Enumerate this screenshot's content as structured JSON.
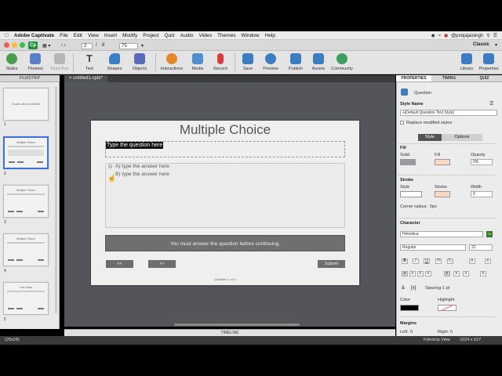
{
  "menubar": {
    "app": "Adobe Captivate",
    "items": [
      "File",
      "Edit",
      "View",
      "Insert",
      "Modify",
      "Project",
      "Quiz",
      "Audio",
      "Video",
      "Themes",
      "Window",
      "Help"
    ],
    "user": "@poojajaisingh"
  },
  "titlebar": {
    "logo": "Cp",
    "page_current": "2",
    "page_sep": "/",
    "page_total": "8",
    "zoom": "75",
    "mode": "Classic"
  },
  "toolbar": {
    "items": [
      {
        "label": "Slides",
        "icon": "slides-icon",
        "color": "#4a9d4f"
      },
      {
        "label": "Themes",
        "icon": "themes-icon",
        "color": "#5a7fc9"
      },
      {
        "label": "Fluid Box",
        "icon": "fluid-box-icon",
        "color": "#b7b7b7"
      },
      {
        "label": "Text",
        "icon": "text-icon",
        "color": "#444444"
      },
      {
        "label": "Shapes",
        "icon": "shapes-icon",
        "color": "#3a7fc1"
      },
      {
        "label": "Objects",
        "icon": "objects-icon",
        "color": "#5c6bb8"
      },
      {
        "label": "Interactions",
        "icon": "interactions-icon",
        "color": "#e0882c"
      },
      {
        "label": "Media",
        "icon": "media-icon",
        "color": "#4f8fcf"
      },
      {
        "label": "Record",
        "icon": "record-icon",
        "color": "#d93a3a"
      },
      {
        "label": "Save",
        "icon": "save-icon",
        "color": "#3c7cc1"
      },
      {
        "label": "Preview",
        "icon": "preview-icon",
        "color": "#3c7cc1"
      },
      {
        "label": "Publish",
        "icon": "publish-icon",
        "color": "#3c7cc1"
      },
      {
        "label": "Assets",
        "icon": "assets-icon",
        "color": "#3c7cc1"
      },
      {
        "label": "Community",
        "icon": "community-icon",
        "color": "#3aa060"
      },
      {
        "label": "Library",
        "icon": "library-icon",
        "color": "#3c7cc1"
      },
      {
        "label": "Properties",
        "icon": "properties-icon",
        "color": "#3c7cc1"
      }
    ]
  },
  "filmstrip": {
    "header": "FILMSTRIP",
    "slides": [
      {
        "num": "1",
        "title": "Double click to edit title"
      },
      {
        "num": "2",
        "title": "Multiple Choice"
      },
      {
        "num": "3",
        "title": "Multiple Choice"
      },
      {
        "num": "4",
        "title": "Multiple Choice"
      },
      {
        "num": "5",
        "title": "True False"
      }
    ]
  },
  "document": {
    "tab": "untitled1.cptx*"
  },
  "slide": {
    "title": "Multiple Choice",
    "question": "Type the question here",
    "answers": [
      "A) type the answer here",
      "B) type the answer here"
    ],
    "warning": "You must answer the question before continuing.",
    "back": "<<",
    "next": ">>",
    "submit": "Submit",
    "counter": "Question 1 of 4"
  },
  "timeline": {
    "label": "TIMELINE"
  },
  "properties": {
    "tabs": [
      "PROPERTIES",
      "TIMING",
      "QUIZ"
    ],
    "object_type": "Question",
    "style_name_label": "Style Name",
    "style_name": "+[Default Question Text Style]",
    "replace_label": "Replace modified styles",
    "subtabs": [
      "Style",
      "Options"
    ],
    "fill": {
      "heading": "Fill",
      "solid": "Solid",
      "fill": "Fill",
      "opacity_label": "Opacity",
      "opacity": "0%"
    },
    "stroke": {
      "heading": "Stroke",
      "style": "Style",
      "stroke": "Stroke",
      "width_label": "Width",
      "width": "0"
    },
    "corner_radius_label": "Corner radius:",
    "corner_radius": "0px",
    "character": {
      "heading": "Character",
      "font": "Helvetica",
      "weight": "Regular",
      "size": "22"
    },
    "spacing_label": "Spacing:",
    "spacing": "1 pt",
    "color_label": "Color",
    "highlight_label": "Highlight",
    "margins_heading": "Margins",
    "left_label": "Left:",
    "left": "0",
    "right_label": "Right:",
    "right": "0"
  },
  "status": {
    "left": "(20x24)",
    "view": "Filmstrip View",
    "size": "1024 x 627"
  },
  "colors": {
    "accent": "#3d72d9",
    "stage": "#54555b",
    "warn": "#6f6f6f",
    "fill_swatch": "#f8d9c2"
  }
}
